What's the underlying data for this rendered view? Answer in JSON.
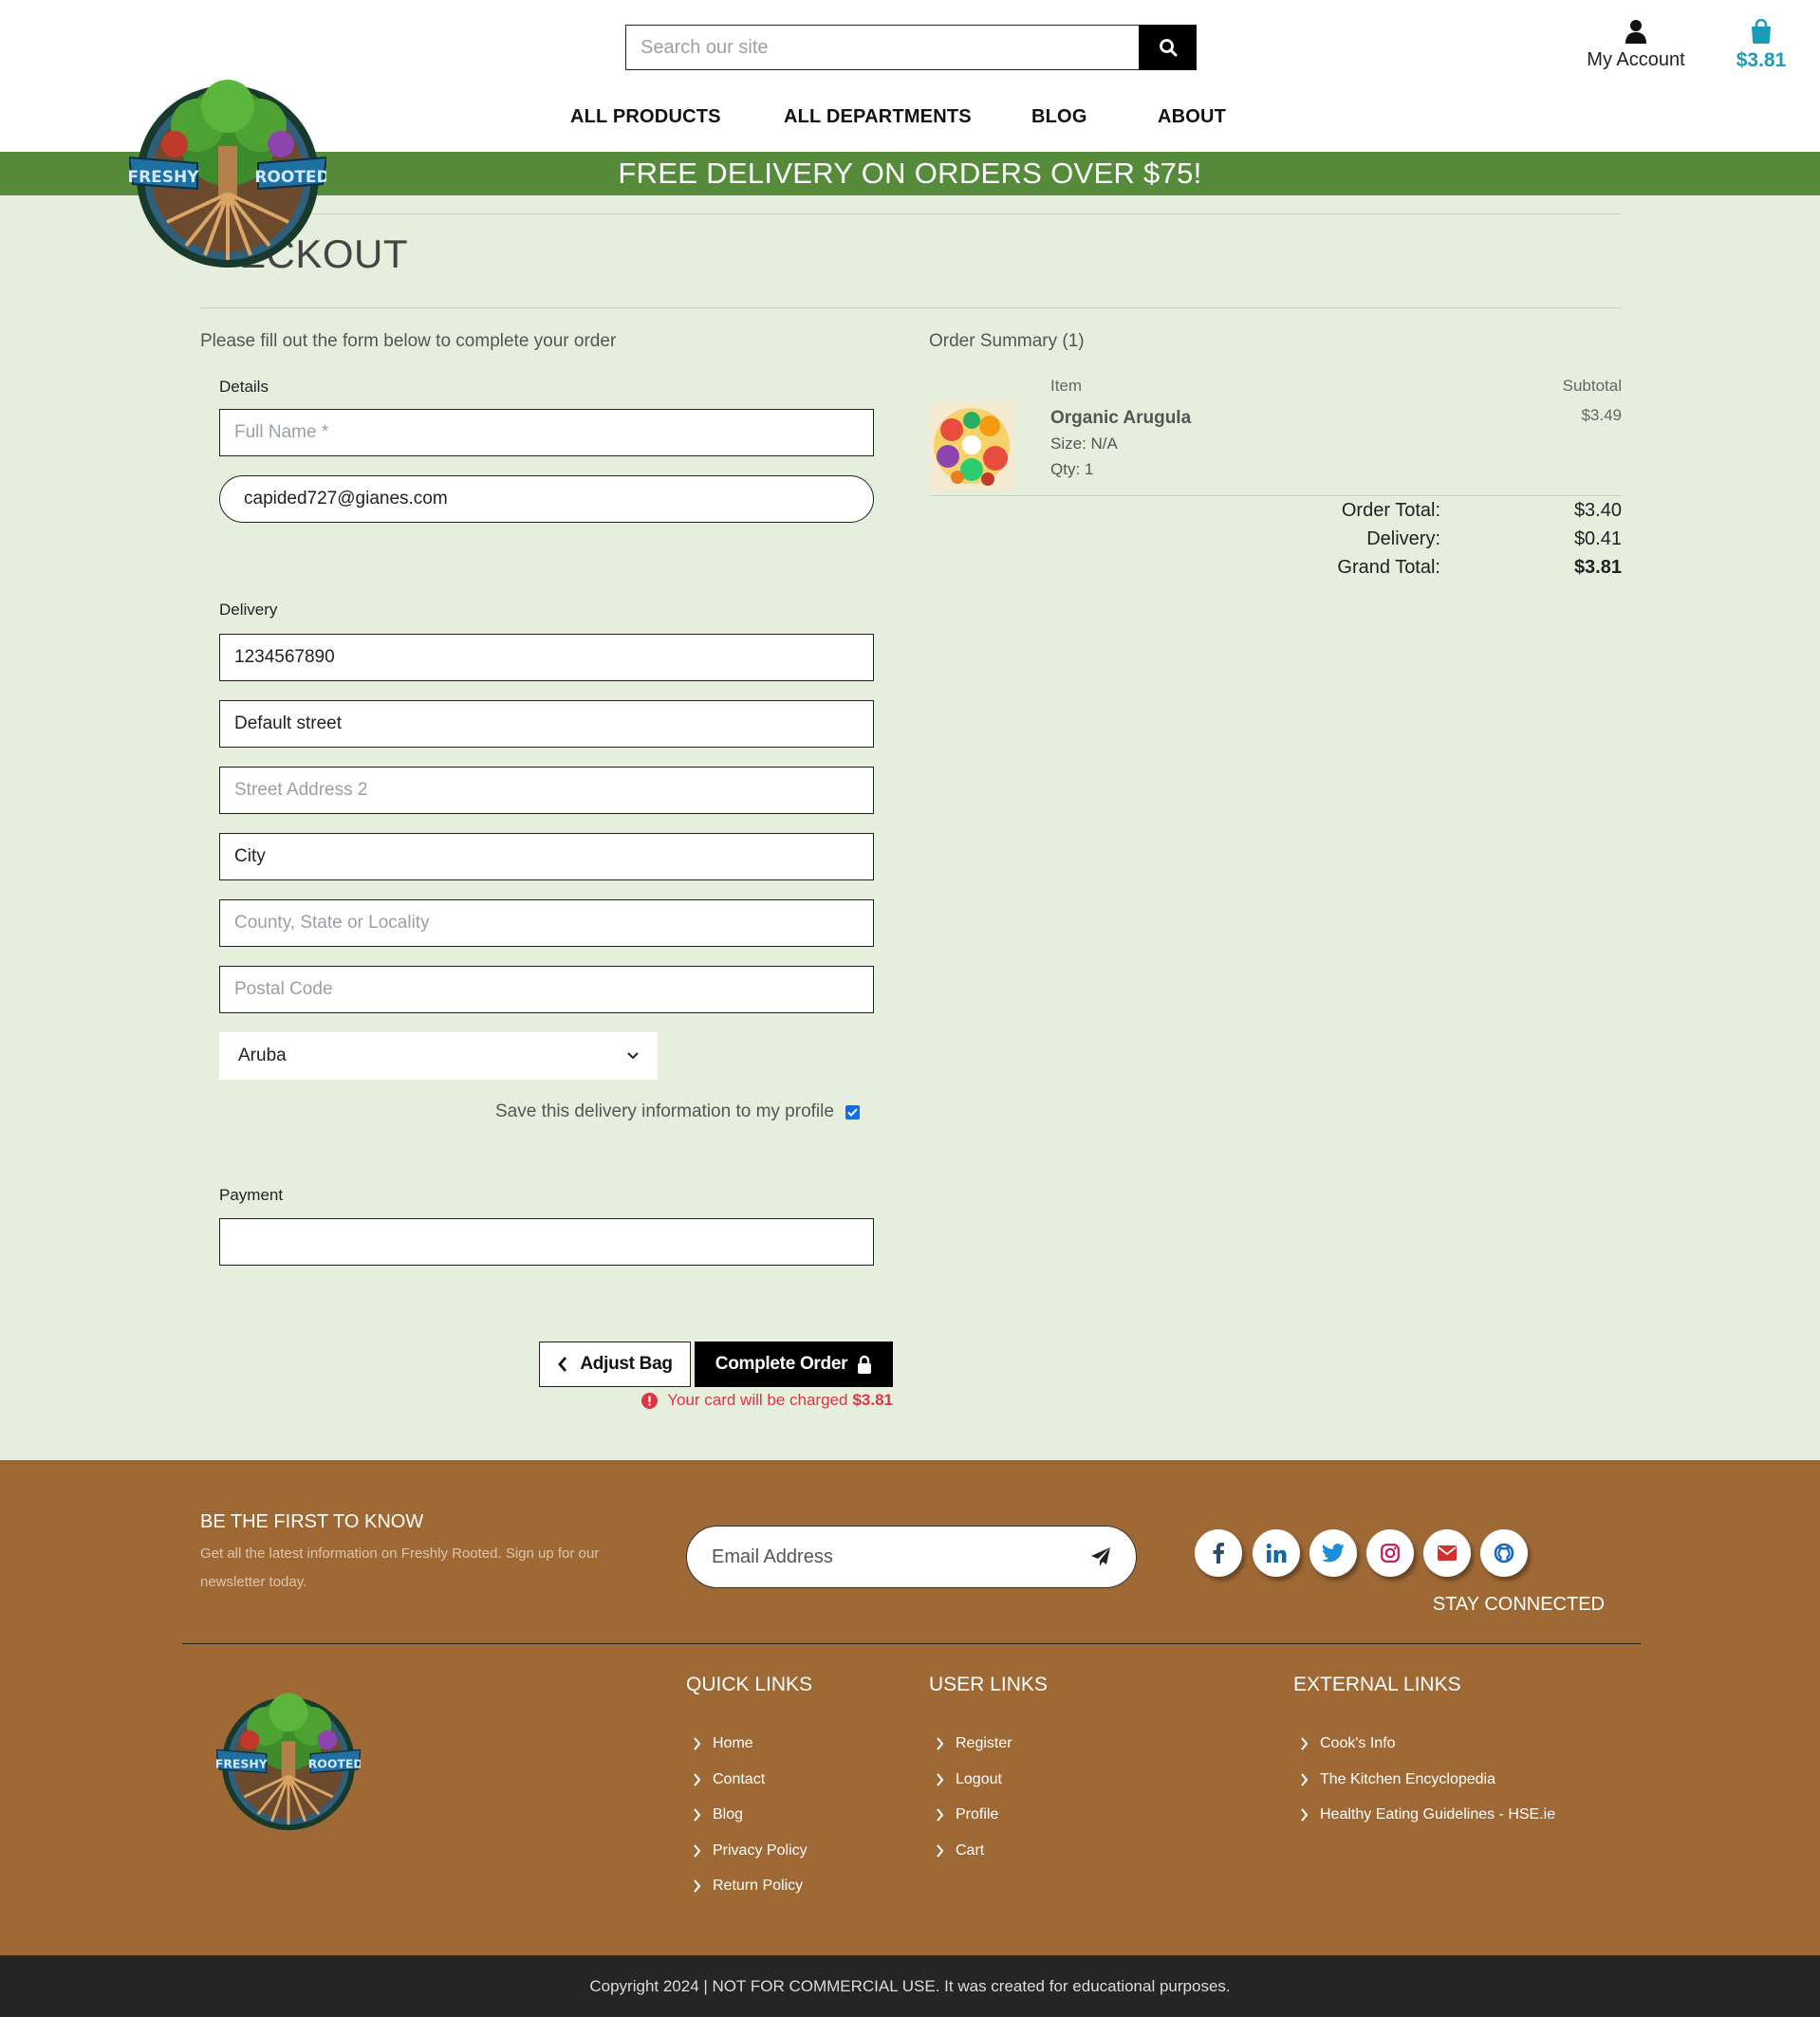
{
  "header": {
    "search_placeholder": "Search our site",
    "account_label": "My Account",
    "bag_total": "$3.81",
    "nav": [
      "ALL PRODUCTS",
      "ALL DEPARTMENTS",
      "BLOG",
      "ABOUT"
    ],
    "banner": "FREE DELIVERY ON ORDERS OVER $75!",
    "logo_text": {
      "left": "FRESHY",
      "right": "ROOTED"
    }
  },
  "page": {
    "title": "CHECKOUT",
    "visible_title": "ECKOUT",
    "intro": "Please fill out the form below to complete your order"
  },
  "form": {
    "details_label": "Details",
    "full_name_placeholder": "Full Name *",
    "email_value": "capided727@gianes.com",
    "delivery_label": "Delivery",
    "phone_value": "1234567890",
    "street1_value": "Default street",
    "street2_placeholder": "Street Address 2",
    "city_value": "City",
    "county_placeholder": "County, State or Locality",
    "postal_placeholder": "Postal Code",
    "country_value": "Aruba",
    "save_info_label": "Save this delivery information to my profile",
    "save_info_checked": true,
    "payment_label": "Payment",
    "adjust_bag": "Adjust Bag",
    "complete_order": "Complete Order",
    "charge_text": "Your card will be charged",
    "charge_amount": "$3.81"
  },
  "summary": {
    "title": "Order Summary (1)",
    "col_item": "Item",
    "col_subtotal": "Subtotal",
    "item": {
      "name": "Organic Arugula",
      "size": "Size: N/A",
      "qty": "Qty: 1",
      "price": "$3.49"
    },
    "order_total_label": "Order Total:",
    "order_total": "$3.40",
    "delivery_label": "Delivery:",
    "delivery": "$0.41",
    "grand_total_label": "Grand Total:",
    "grand_total": "$3.81"
  },
  "footer": {
    "newsletter_title": "BE THE FIRST TO KNOW",
    "newsletter_sub": "Get all the latest information on Freshly Rooted. Sign up for our newsletter today.",
    "email_placeholder": "Email Address",
    "stay_connected": "STAY CONNECTED",
    "quick_links_title": "QUICK LINKS",
    "quick_links": [
      "Home",
      "Contact",
      "Blog",
      "Privacy Policy",
      "Return Policy"
    ],
    "user_links_title": "USER LINKS",
    "user_links": [
      "Register",
      "Logout",
      "Profile",
      "Cart"
    ],
    "external_links_title": "EXTERNAL LINKS",
    "external_links": [
      "Cook's Info",
      "The Kitchen Encyclopedia",
      "Healthy Eating Guidelines - HSE.ie"
    ],
    "copyright": "Copyright 2024 | NOT FOR COMMERCIAL USE. It was created for educational purposes."
  },
  "colors": {
    "banner": "#558b3a",
    "page_bg": "#e6efdd",
    "footer": "#9f6936",
    "accent_bag": "#1b9bb5",
    "error": "#dc3545"
  },
  "icons": [
    "search-icon",
    "user-icon",
    "shopping-bag-icon",
    "chevron-left-icon",
    "lock-icon",
    "exclamation-circle-icon",
    "paper-plane-icon",
    "facebook-icon",
    "linkedin-icon",
    "twitter-icon",
    "instagram-icon",
    "envelope-icon",
    "github-icon",
    "chevron-right-icon"
  ]
}
